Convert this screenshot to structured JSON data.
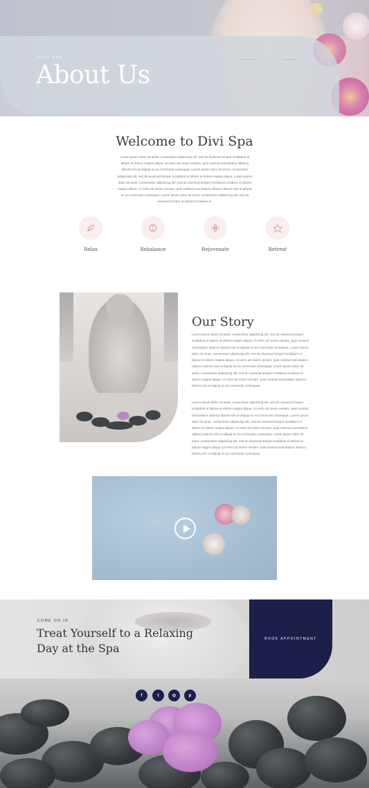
{
  "hero": {
    "eyebrow": "DIVI SPA",
    "title": "About Us"
  },
  "welcome": {
    "title": "Welcome to Divi Spa",
    "body": "Lorem ipsum dolor sit amet, consectetur adipiscing elit, sed do eiusmod tempor incididunt ut labore et dolore magna aliqua. Ut enim ad minim veniam, quis nostrud exercitation ullamco laboris nisi ut aliquip ex ea commodo consequat. Lorem ipsum dolor sit amet, consectetur adipiscing elit, sed do eiusmod tempor incididunt ut labore et dolore magna aliqua. Lorem ipsum dolor sit amet, consectetur adipiscing elit, sed do eiusmod tempor incididunt ut labore et dolore magna aliqua. Ut enim ad minim veniam, quis nostrud exercitation ullamco laboris nisi ut aliquip ex ea commodo consequat. Lorem ipsum dolor sit amet, consectetur adipiscing elit, sed do eiusmod tempor incididunt ut labore et."
  },
  "features": [
    {
      "label": "Relax",
      "icon": "leaf-icon"
    },
    {
      "label": "Rebalance",
      "icon": "balance-icon"
    },
    {
      "label": "Rejuvenate",
      "icon": "flower-icon"
    },
    {
      "label": "Retreat",
      "icon": "lotus-icon"
    }
  ],
  "story": {
    "title": "Our Story",
    "paragraph_1": "Lorem ipsum dolor sit amet, consectetur adipiscing elit, sed do eiusmod tempor incididunt ut labore et dolore magna aliqua. Ut enim ad minim veniam, quis nostrud exercitation ullamco laboris nisi ut aliquip ex ea commodo consequat. Lorem ipsum dolor sit amet, consectetur adipiscing elit, sed do eiusmod tempor incididunt ut labore et dolore magna aliqua. Ut enim ad minim veniam, quis nostrud exercitation ullamco laboris nisi ut aliquip ex ea commodo consequat. Lorem ipsum dolor sit amet, consectetur adipiscing elit, sed do eiusmod tempor incididunt ut labore et dolore magna aliqua. Ut enim ad minim veniam, quis nostrud exercitation ullamco laboris nisi ut aliquip ex ea commodo consequat.",
    "paragraph_2": "Lorem ipsum dolor sit amet, consectetur adipiscing elit, sed do eiusmod tempor incididunt ut labore et dolore magna aliqua. Ut enim ad minim veniam, quis nostrud exercitation ullamco laboris nisi ut aliquip ex ea commodo consequat. Lorem ipsum dolor sit amet, consectetur adipiscing elit, sed do eiusmod tempor incididunt ut labore et dolore magna aliqua. Ut enim ad minim veniam, quis nostrud exercitation ullamco laboris nisi ut aliquip ex ea commodo consequat. Lorem ipsum dolor sit amet, consectetur adipiscing elit, sed do eiusmod tempor incididunt ut labore et dolore magna aliqua. Ut enim ad minim veniam, quis nostrud exercitation ullamco laboris nisi ut aliquip ex ea commodo consequat."
  },
  "video": {
    "play_icon": "play-icon"
  },
  "cta": {
    "eyebrow": "COME ON IN",
    "title": "Treat Yourself to a Relaxing Day at the Spa",
    "button_label": "BOOK APPOINTMENT"
  },
  "social": [
    {
      "name": "facebook-icon",
      "glyph": "f"
    },
    {
      "name": "twitter-icon",
      "glyph": "t"
    },
    {
      "name": "instagram-icon",
      "glyph": "◎"
    },
    {
      "name": "pinterest-icon",
      "glyph": "p"
    }
  ],
  "colors": {
    "accent_navy": "#1c1f4a",
    "icon_pink": "#fbeeee",
    "icon_stroke": "#c98a83"
  }
}
